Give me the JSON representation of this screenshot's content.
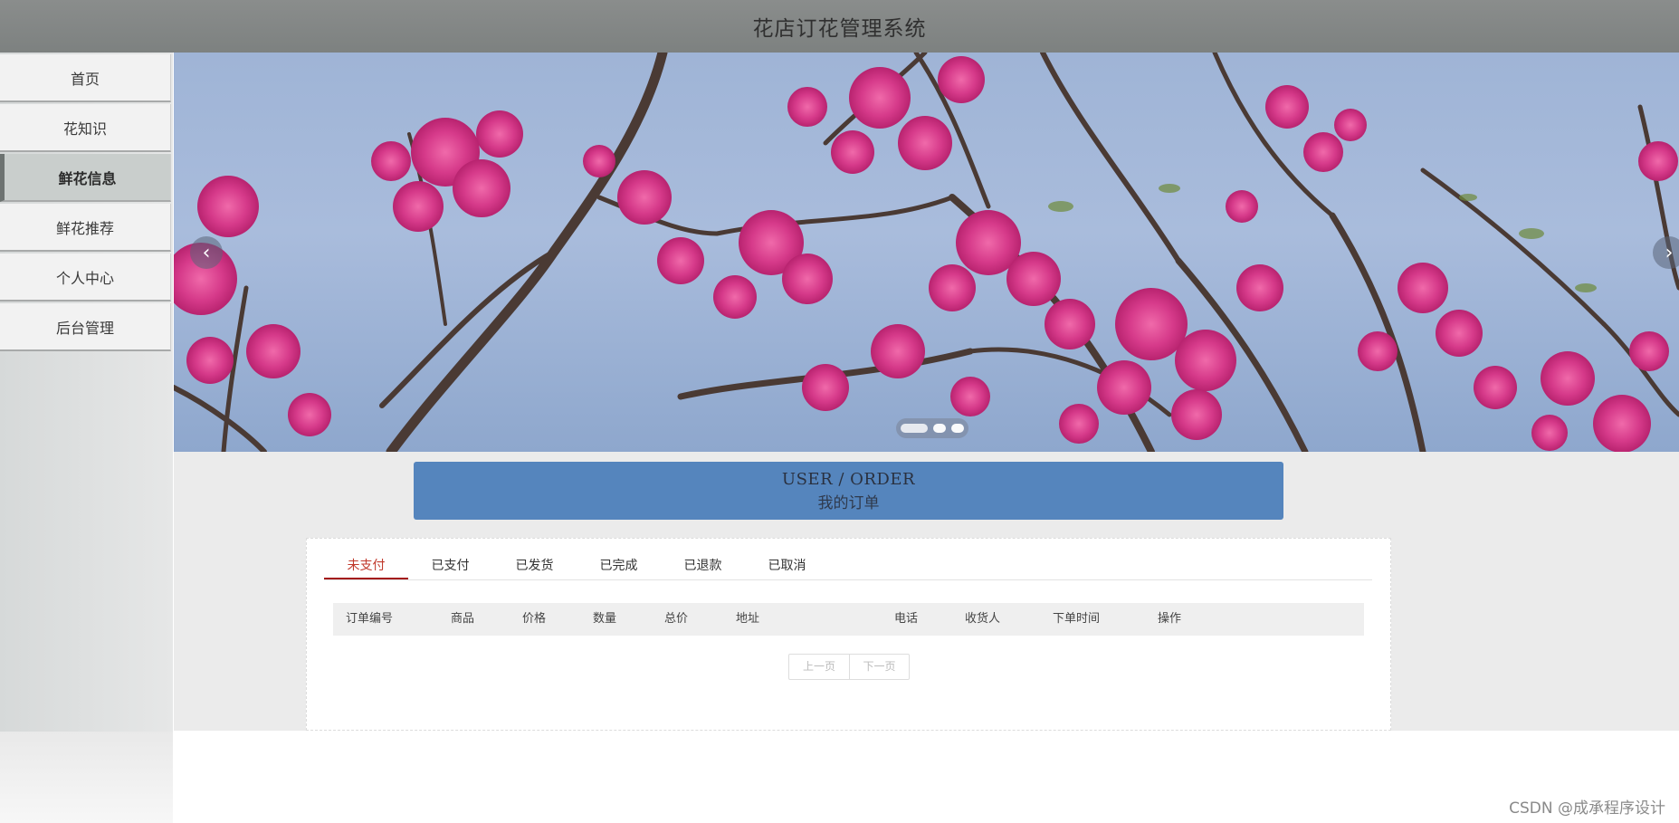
{
  "header": {
    "title": "花店订花管理系统"
  },
  "sidebar": {
    "items": [
      {
        "label": "首页"
      },
      {
        "label": "花知识"
      },
      {
        "label": "鲜花信息",
        "active": true
      },
      {
        "label": "鲜花推荐"
      },
      {
        "label": "个人中心"
      },
      {
        "label": "后台管理"
      }
    ]
  },
  "banner": {
    "prev_icon": "chevron-left-icon",
    "next_icon": "chevron-right-icon",
    "slide_count": 3,
    "colors": {
      "sky": "#a9bcdc",
      "blossom": "#d63a8a",
      "branch": "#4a3a34"
    }
  },
  "order_title": {
    "en": "USER / ORDER",
    "cn": "我的订单"
  },
  "tabs": [
    {
      "label": "未支付",
      "active": true
    },
    {
      "label": "已支付"
    },
    {
      "label": "已发货"
    },
    {
      "label": "已完成"
    },
    {
      "label": "已退款"
    },
    {
      "label": "已取消"
    }
  ],
  "table": {
    "headers": [
      "订单编号",
      "商品",
      "价格",
      "数量",
      "总价",
      "地址",
      "电话",
      "收货人",
      "下单时间",
      "操作"
    ]
  },
  "pager": {
    "prev": "上一页",
    "next": "下一页"
  },
  "watermark": "CSDN @成承程序设计",
  "colors": {
    "accent": "#5585bd",
    "active_tab": "#c0392b",
    "header_bg": "#7d8180"
  }
}
